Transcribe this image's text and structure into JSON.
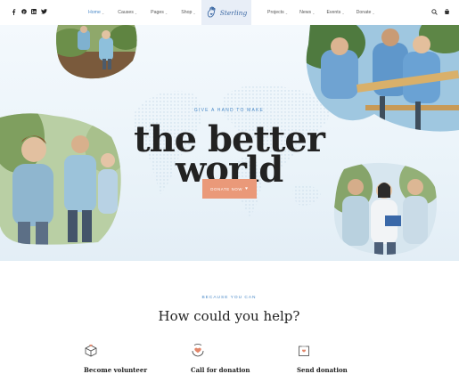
{
  "header": {
    "social": [
      "facebook-icon",
      "pinterest-icon",
      "linkedin-icon",
      "twitter-icon"
    ],
    "nav_left": [
      {
        "label": "Home",
        "active": true
      },
      {
        "label": "Causes",
        "active": false
      },
      {
        "label": "Pages",
        "active": false
      },
      {
        "label": "Shop",
        "active": false
      }
    ],
    "logo_text": "Sterling",
    "nav_right": [
      {
        "label": "Projects",
        "active": false
      },
      {
        "label": "News",
        "active": false
      },
      {
        "label": "Events",
        "active": false
      },
      {
        "label": "Donate",
        "active": false
      }
    ],
    "icons": [
      "search-icon",
      "cart-icon"
    ]
  },
  "hero": {
    "kicker": "GIVE A HAND TO MAKE",
    "headline_line1": "the better",
    "headline_line2": "world",
    "donate_label": "DONATE NOW"
  },
  "help": {
    "kicker": "BECAUSE YOU CAN",
    "title": "How could you help?",
    "cards": [
      {
        "label": "Become volunteer",
        "icon": "volunteer-box-icon"
      },
      {
        "label": "Call for donation",
        "icon": "heart-hands-icon"
      },
      {
        "label": "Send donation",
        "icon": "donation-box-icon"
      }
    ]
  },
  "colors": {
    "accent_blue": "#4b8ac8",
    "button_coral": "#ea9979",
    "headline": "#222222",
    "hero_bg": "#eaf3f9",
    "logo_bg": "#e8eef7"
  }
}
